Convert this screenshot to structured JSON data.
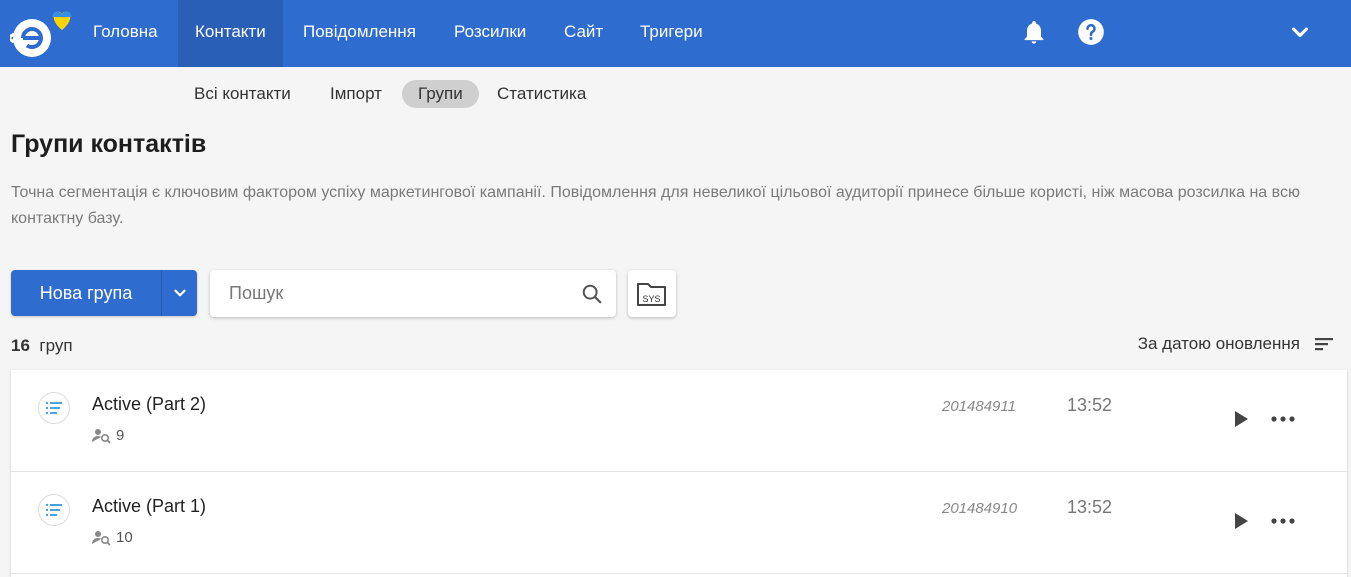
{
  "nav": {
    "items": [
      {
        "label": "Головна"
      },
      {
        "label": "Контакти"
      },
      {
        "label": "Повідомлення"
      },
      {
        "label": "Розсилки"
      },
      {
        "label": "Сайт"
      },
      {
        "label": "Тригери"
      }
    ],
    "active_index": 1
  },
  "subnav": {
    "items": [
      {
        "label": "Всі контакти"
      },
      {
        "label": "Імпорт"
      },
      {
        "label": "Групи"
      },
      {
        "label": "Статистика"
      }
    ],
    "active_index": 2
  },
  "page": {
    "title": "Групи контактів",
    "description": "Точна сегментація є ключовим фактором успіху маркетингової кампанії. Повідомлення для невеликої цільової аудиторії принесе більше користі, ніж масова розсилка на всю контактну базу."
  },
  "toolbar": {
    "new_group_label": "Нова група",
    "search_placeholder": "Пошук",
    "sys_label": "SYS"
  },
  "summary": {
    "count": "16",
    "count_suffix": "груп",
    "sort_label": "За датою оновлення"
  },
  "groups": [
    {
      "name": "Active (Part 2)",
      "members": "9",
      "id": "201484911",
      "time": "13:52"
    },
    {
      "name": "Active (Part 1)",
      "members": "10",
      "id": "201484910",
      "time": "13:52"
    }
  ],
  "colors": {
    "brand": "#2f6ccf",
    "brand_dark": "#2a5fb8",
    "group_icon": "#4aa3e0"
  }
}
